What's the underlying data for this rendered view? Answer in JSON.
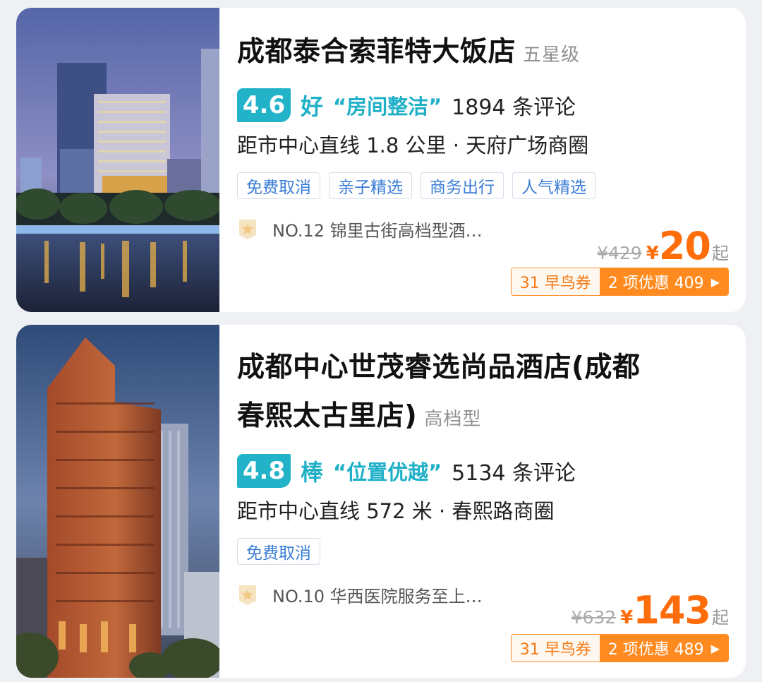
{
  "hotels": [
    {
      "name": "成都泰合索菲特大饭店",
      "star_level": "五星级",
      "score": "4.6",
      "grade": "好",
      "quote": "“房间整洁”",
      "reviews": "1894 条评论",
      "distance": "距市中心直线 1.8 公里 · 天府广场商圈",
      "tags": [
        "免费取消",
        "亲子精选",
        "商务出行",
        "人气精选"
      ],
      "rank": "NO.12 锦里古街高档型酒…",
      "original_price": "¥429",
      "currency": "¥",
      "price": "20",
      "price_suffix": "起",
      "coupon": "31 早鸟券",
      "deal": "2 项优惠 409",
      "deal_arrow": "▶"
    },
    {
      "name_line1": "成都中心世茂睿选尚品酒店(成都",
      "name_line2": "春熙太古里店)",
      "star_level": "高档型",
      "score": "4.8",
      "grade": "棒",
      "quote": "“位置优越”",
      "reviews": "5134 条评论",
      "distance": "距市中心直线 572 米 · 春熙路商圈",
      "tags": [
        "免费取消"
      ],
      "rank": "NO.10 华西医院服务至上…",
      "original_price": "¥632",
      "currency": "¥",
      "price": "143",
      "price_suffix": "起",
      "coupon": "31 早鸟券",
      "deal": "2 项优惠 489",
      "deal_arrow": "▶"
    }
  ],
  "colors": {
    "score_bg": "#22b3c9",
    "price_accent": "#ff6d0a",
    "tag_text": "#3a7dd6",
    "deal_bg": "#ff8a1f"
  }
}
